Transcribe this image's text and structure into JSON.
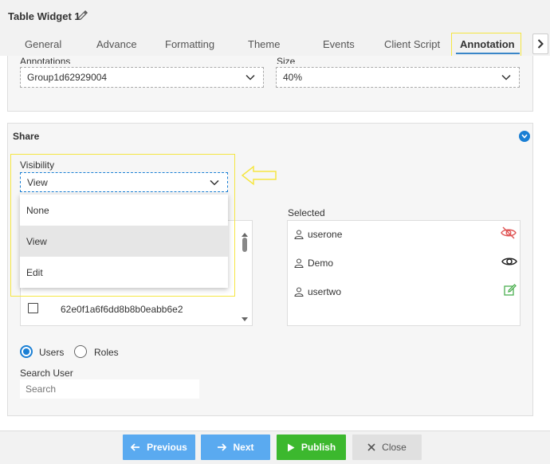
{
  "header": {
    "title": "Table Widget 1"
  },
  "tabs": [
    {
      "label": "General"
    },
    {
      "label": "Advance"
    },
    {
      "label": "Formatting"
    },
    {
      "label": "Theme"
    },
    {
      "label": "Events"
    },
    {
      "label": "Client Script"
    },
    {
      "label": "Annotation",
      "active": true
    }
  ],
  "annotation_section": {
    "annotations_label": "Annotations",
    "annotations_value": "Group1d62929004",
    "size_label": "Size",
    "size_value": "40%"
  },
  "share": {
    "title": "Share",
    "visibility_label": "Visibility",
    "visibility_value": "View",
    "visibility_options": [
      "None",
      "View",
      "Edit"
    ],
    "left_list_partial_item": "62e0f1a6f6dd8b8b0eabb6e2",
    "selected_label": "Selected",
    "selected_users": [
      {
        "name": "userone",
        "access_icon": "eye-slash-icon",
        "color": "#e05555"
      },
      {
        "name": "Demo",
        "access_icon": "eye-icon",
        "color": "#222222"
      },
      {
        "name": "usertwo",
        "access_icon": "edit-icon",
        "color": "#4caf50"
      }
    ],
    "radio_users": "Users",
    "radio_roles": "Roles",
    "radio_selected": "Users",
    "search_user_label": "Search User",
    "search_placeholder": "Search"
  },
  "footer": {
    "previous": "Previous",
    "next": "Next",
    "publish": "Publish",
    "close": "Close"
  },
  "colors": {
    "accent": "#1a7fd4",
    "prev_next_bg": "#5aaaf0",
    "publish_bg": "#3cb82e",
    "close_bg": "#e0e0e0",
    "highlight": "#f5e642"
  }
}
